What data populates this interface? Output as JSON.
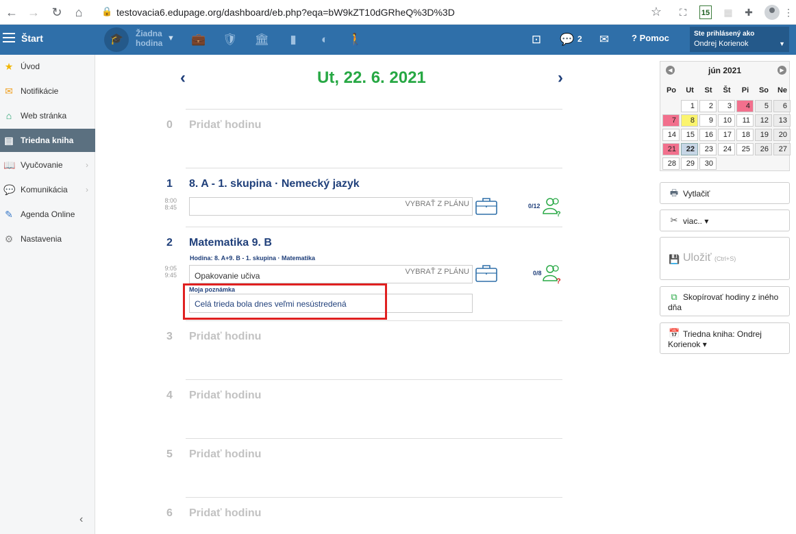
{
  "browser": {
    "url": "testovacia6.edupage.org/dashboard/eb.php?eqa=bW9kZT10dGRheQ%3D%3D",
    "ext_badge": "15"
  },
  "appbar": {
    "start_label": "Štart",
    "no_lesson_line1": "Žiadna",
    "no_lesson_line2": "hodina",
    "messages_count": "2",
    "help_label": "Pomoc",
    "logged_in_label": "Ste prihlásený ako",
    "user_name": "Ondrej Korienok"
  },
  "sidebar": {
    "items": [
      {
        "label": "Úvod",
        "icon": "star-icon",
        "color": "#f2b600"
      },
      {
        "label": "Notifikácie",
        "icon": "envelope-icon",
        "color": "#f0a020"
      },
      {
        "label": "Web stránka",
        "icon": "home-icon",
        "color": "#1e9e6a"
      },
      {
        "label": "Triedna kniha",
        "icon": "notebook-icon",
        "color": "#ffffff"
      },
      {
        "label": "Vyučovanie",
        "icon": "book-icon",
        "color": "#2f6fa9"
      },
      {
        "label": "Komunikácia",
        "icon": "chat-icon",
        "color": "#c0392b"
      },
      {
        "label": "Agenda Online",
        "icon": "pen-icon",
        "color": "#3a7ac8"
      },
      {
        "label": "Nastavenia",
        "icon": "gear-icon",
        "color": "#888888"
      }
    ]
  },
  "main": {
    "date_title": "Ut, 22. 6. 2021",
    "add_lesson_label": "Pridať hodinu",
    "lessons": [
      {
        "num": "0"
      },
      {
        "num": "1",
        "title": "8. A - 1. skupina · Nemecký jazyk",
        "time_start": "8:00",
        "time_end": "8:45",
        "topic": "",
        "pick_plan": "VYBRAŤ Z PLÁNU",
        "attendance": "0/12"
      },
      {
        "num": "2",
        "title": "Matematika  9. B",
        "subtitle": "Hodina:  8. A+9. B - 1. skupina · Matematika",
        "time_start": "9:05",
        "time_end": "9:45",
        "topic": "Opakovanie učiva",
        "pick_plan": "VYBRAŤ Z PLÁNU",
        "attendance": "0/8",
        "note_label": "Moja poznámka",
        "note": "Celá trieda bola dnes veľmi nesústredená"
      },
      {
        "num": "3"
      },
      {
        "num": "4"
      },
      {
        "num": "5"
      },
      {
        "num": "6"
      }
    ]
  },
  "calendar": {
    "month": "jún 2021",
    "dow": [
      "Po",
      "Ut",
      "St",
      "Št",
      "Pi",
      "So",
      "Ne"
    ],
    "weeks": [
      [
        "",
        "1",
        "2",
        "3",
        "4",
        "5",
        "6"
      ],
      [
        "7",
        "8",
        "9",
        "10",
        "11",
        "12",
        "13"
      ],
      [
        "14",
        "15",
        "16",
        "17",
        "18",
        "19",
        "20"
      ],
      [
        "21",
        "22",
        "23",
        "24",
        "25",
        "26",
        "27"
      ],
      [
        "28",
        "29",
        "30",
        "",
        "",
        "",
        ""
      ]
    ],
    "red_days": [
      "4",
      "7",
      "21"
    ],
    "yellow_days": [
      "8"
    ],
    "selected_day": "22"
  },
  "actions": {
    "print": "Vytlačiť",
    "more": "viac.. ▾",
    "save": "Uložiť",
    "save_hint": "(Ctrl+S)",
    "copy_line1": "Skopírovať hodiny z iného",
    "copy_line2": "dňa",
    "classbook_line1": "Triedna kniha: Ondrej",
    "classbook_line2": "Korienok ▾"
  }
}
